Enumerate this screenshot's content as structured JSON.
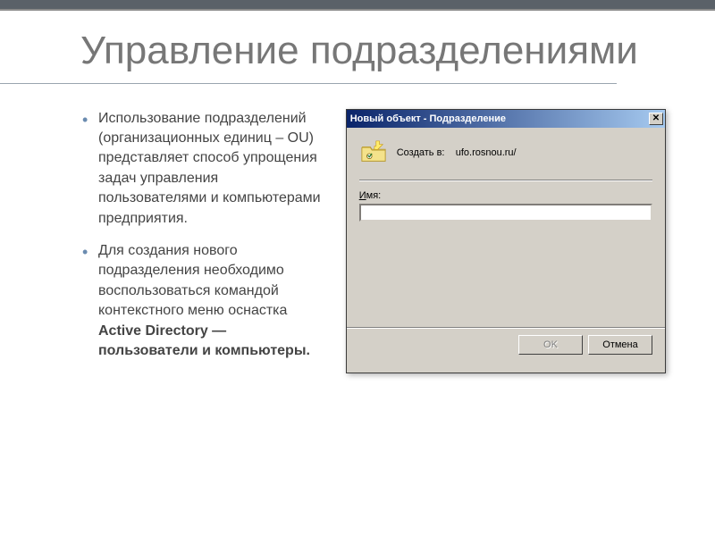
{
  "slide": {
    "title": "Управление подразделениями",
    "bullets": [
      {
        "text": "Использование подразделений (организационных единиц – OU) представляет способ упрощения задач управления пользователями и компьютерами предприятия."
      },
      {
        "text": "Для создания нового подразделения необходимо воспользоваться командой контекстного меню оснастка ",
        "bold_suffix": "Active Directory — пользователи и компьютеры."
      }
    ]
  },
  "dialog": {
    "title": "Новый объект - Подразделение",
    "create_in_label": "Создать в:",
    "create_in_path": "ufo.rosnou.ru/",
    "name_label": "Имя:",
    "name_value": "",
    "ok_label": "OK",
    "cancel_label": "Отмена"
  }
}
